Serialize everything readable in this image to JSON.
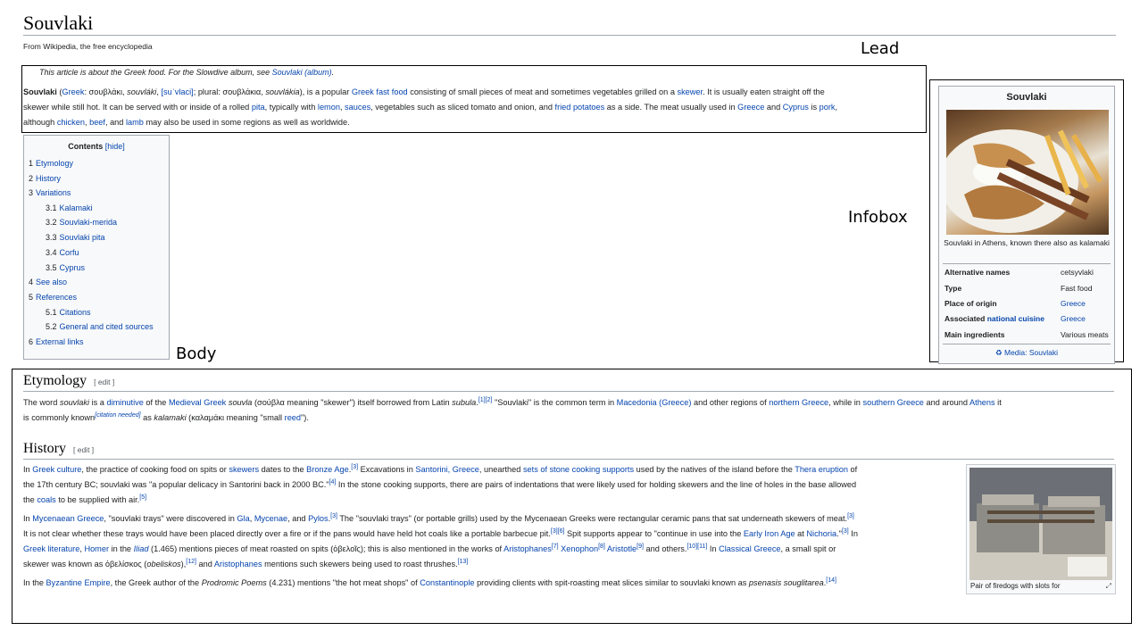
{
  "page": {
    "title": "Souvlaki",
    "tagline": "From Wikipedia, the free encyclopedia"
  },
  "annotations": {
    "lead": "Lead",
    "infobox": "Infobox",
    "body": "Body"
  },
  "hatnote": {
    "text": "This article is about the Greek food. For the Slowdive album, see ",
    "link": "Souvlaki (album)",
    "end": "."
  },
  "lead": {
    "line1_a": "Souvlaki",
    "line1_b": " (",
    "greek_link": "Greek",
    "line1_c": ": σουβλάκι, ",
    "souvlaki_it": "souvláki",
    "line1_d": ", ",
    "ipa_link": "[suˈvlaci]",
    "line1_e": "; plural: σουβλάκια, ",
    "plural_it": "souvlákia",
    "line1_f": "), is a popular ",
    "fastfood_link": "Greek fast food",
    "line1_g": " consisting of small pieces of meat and sometimes vegetables grilled on a ",
    "skewer_link": "skewer",
    "line1_h": ". It is usually eaten straight off the",
    "line2_a": "skewer while still hot. It can be served with or inside of a rolled ",
    "pita_link": "pita",
    "line2_b": ", typically with ",
    "lemon_link": "lemon",
    "line2_c": ", ",
    "sauces_link": "sauces",
    "line2_d": ", vegetables such as sliced tomato and onion, and ",
    "fries_link": "fried potatoes",
    "line2_e": " as a side. The meat usually used in ",
    "greece_link": "Greece",
    "line2_f": " and ",
    "cyprus_link": "Cyprus",
    "line2_g": " is ",
    "pork_link": "pork",
    "line2_h": ",",
    "line3_a": "although ",
    "chicken_link": "chicken",
    "line3_b": ", ",
    "beef_link": "beef",
    "line3_c": ", and ",
    "lamb_link": "lamb",
    "line3_d": " may also be used in some regions as well as worldwide."
  },
  "toc": {
    "title": "Contents",
    "hide": "[hide]",
    "items": [
      {
        "num": "1",
        "label": "Etymology"
      },
      {
        "num": "2",
        "label": "History"
      },
      {
        "num": "3",
        "label": "Variations"
      },
      {
        "num": "3.1",
        "label": "Kalamaki"
      },
      {
        "num": "3.2",
        "label": "Souvlaki-merida"
      },
      {
        "num": "3.3",
        "label": "Souvlaki pita"
      },
      {
        "num": "3.4",
        "label": "Corfu"
      },
      {
        "num": "3.5",
        "label": "Cyprus"
      },
      {
        "num": "4",
        "label": "See also"
      },
      {
        "num": "5",
        "label": "References"
      },
      {
        "num": "5.1",
        "label": "Citations"
      },
      {
        "num": "5.2",
        "label": "General and cited sources"
      },
      {
        "num": "6",
        "label": "External links"
      }
    ]
  },
  "infobox": {
    "title": "Souvlaki",
    "caption": "Souvlaki in Athens, known there also as kalamaki",
    "rows": [
      {
        "label": "Alternative names",
        "value": "cetsyvlaki"
      },
      {
        "label": "Type",
        "value": "Fast food"
      },
      {
        "label": "Place of origin",
        "value": "Greece"
      },
      {
        "label_a": "Associated ",
        "label_link": "national cuisine",
        "value": "Greece"
      },
      {
        "label": "Main ingredients",
        "value": "Various meats"
      }
    ],
    "media": "Media: Souvlaki"
  },
  "etymology": {
    "heading": "Etymology",
    "edit": "[ edit ]",
    "p1_a": "The word ",
    "p1_it": "souvlaki",
    "p1_b": " is a ",
    "diminutive_link": "diminutive",
    "p1_c": " of the ",
    "medgreek_link": "Medieval Greek",
    "p1_d": " ",
    "souvla_it": "souvla",
    "p1_e": " (σούβλα meaning \"skewer\") itself borrowed from Latin ",
    "subula_it": "subula",
    "p1_f": ".",
    "ref12": "[1][2]",
    "p1_g": " \"Souvlaki\" is the common term in ",
    "macedonia_link": "Macedonia (Greece)",
    "p1_h": " and other regions of ",
    "northern_link": "northern Greece",
    "p1_i": ", while in ",
    "southern_link": "southern Greece",
    "p1_j": " and around ",
    "athens_link": "Athens",
    "p1_k": " it",
    "p2_a": "is commonly known",
    "citation": "[citation needed]",
    "p2_b": " as ",
    "kalamaki_it": "kalamaki",
    "p2_c": " (καλαμάκι meaning \"small ",
    "reed_link": "reed",
    "p2_d": "\")."
  },
  "history": {
    "heading": "History",
    "edit": "[ edit ]",
    "h1_a": "In ",
    "culture_link": "Greek culture",
    "h1_b": ", the practice of cooking food on spits or ",
    "skewers_link": "skewers",
    "h1_c": " dates to the ",
    "bronze_link": "Bronze Age",
    "h1_d": ".",
    "ref3": "[3]",
    "h1_e": " Excavations in ",
    "santorini_link": "Santorini, Greece",
    "h1_f": ", unearthed ",
    "stone_link": "sets of stone cooking supports",
    "h1_g": " used by the natives of the island before the ",
    "thera_link": "Thera eruption",
    "h1_h": " of",
    "h2_a": "the 17th century BC; souvlaki was \"a popular delicacy in Santorini back in 2000 BC.\"",
    "ref4": "[4]",
    "h2_b": " In the stone cooking supports, there are pairs of indentations that were likely used for holding skewers and the line of holes in the base allowed",
    "h3_a": "the ",
    "coals_link": "coals",
    "h3_b": " to be supplied with air.",
    "ref5": "[5]",
    "m1_a": "In ",
    "myc_link": "Mycenaean Greece",
    "m1_b": ", \"souvlaki trays\" were discovered in ",
    "gla_link": "Gla",
    "m1_c": ", ",
    "mycenae_link": "Mycenae",
    "m1_d": ", and ",
    "pylos_link": "Pylos",
    "m1_e": ".",
    "m_ref3": "[3]",
    "m1_f": " The \"souvlaki trays\" (or portable grills) used by the Mycenaean Greeks were rectangular ceramic pans that sat underneath skewers of meat.",
    "m_ref3b": "[3]",
    "m2_a": "It is not clear whether these trays would have been placed directly over a fire or if the pans would have held hot coals like a portable barbecue pit.",
    "m_ref36": "[3][6]",
    "m2_b": " Spit supports appear to \"continue in use into the ",
    "eia_link": "Early Iron Age",
    "m2_c": " at ",
    "nichoria_link": "Nichoria",
    "m2_d": ".\"",
    "m_ref3c": "[3]",
    "m2_e": " In",
    "m3_lit_link": "Greek literature",
    "m3_a": ", ",
    "homer_link": "Homer",
    "m3_b": " in the ",
    "iliad_it": "Iliad",
    "m3_c": " (1.465) mentions pieces of meat roasted on spits (ὀβελοῖς); this is also mentioned in the works of ",
    "aristophanes_link": "Aristophanes",
    "m_ref7": "[7]",
    "m3_d": " ",
    "xenophon_link": "Xenophon",
    "m_ref8": "[8]",
    "m3_e": " ",
    "aristotle_link": "Aristotle",
    "m_ref9": "[9]",
    "m3_f": " and others.",
    "m_ref1011": "[10][11]",
    "m3_g": " In ",
    "classical_link": "Classical Greece",
    "m3_h": ", a small spit or",
    "m4_a": "skewer was known as ὀβελίσκος (",
    "obeliskos_it": "obeliskos",
    "m4_b": "),",
    "m_ref12": "[12]",
    "m4_c": " and ",
    "aristophanes2_link": "Aristophanes",
    "m4_d": " mentions such skewers being used to roast thrushes.",
    "m_ref13": "[13]",
    "b1_a": "In the ",
    "byz_link": "Byzantine Empire",
    "b1_b": ", the Greek author of the ",
    "prodromic_it": "Prodromic Poems",
    "b1_c": " (4.231) mentions \"the hot meat shops\" of ",
    "const_link": "Constantinople",
    "b1_d": " providing clients with spit-roasting meat slices similar to souvlaki known as ",
    "psenasis_it": "psenasis souglitarea",
    "b1_e": ".",
    "ref14": "[14]",
    "thumb_caption": "Pair of firedogs with slots for",
    "enlarge_icon": "⤢"
  }
}
